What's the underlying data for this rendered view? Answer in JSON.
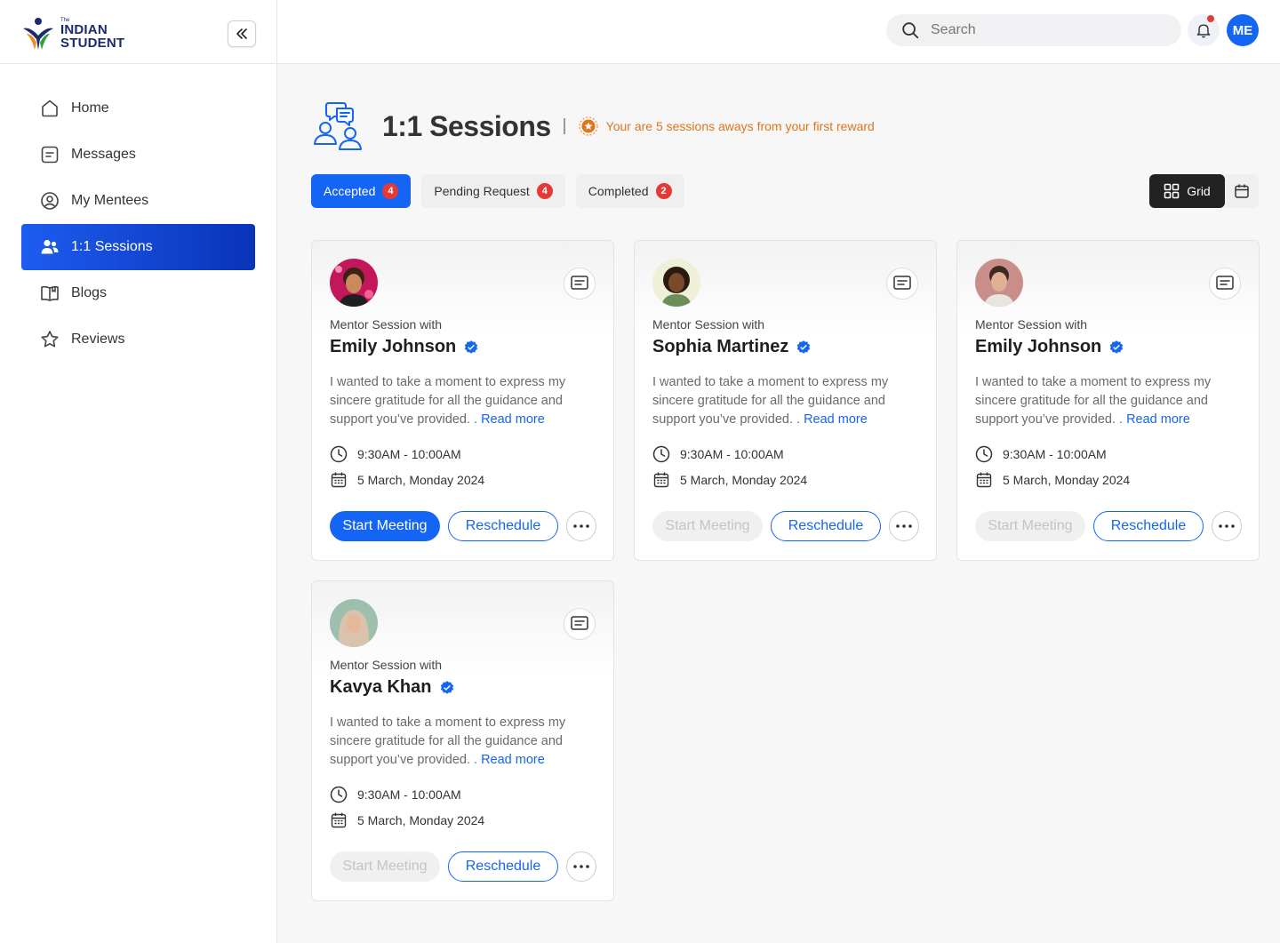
{
  "brand": {
    "small": "The",
    "line1": "INDIAN",
    "line2": "STUDENT"
  },
  "sidebar": {
    "items": [
      {
        "label": "Home",
        "icon": "home-icon"
      },
      {
        "label": "Messages",
        "icon": "message-icon"
      },
      {
        "label": "My Mentees",
        "icon": "user-circle-icon"
      },
      {
        "label": "1:1 Sessions",
        "icon": "users-icon",
        "active": true
      },
      {
        "label": "Blogs",
        "icon": "book-icon"
      },
      {
        "label": "Reviews",
        "icon": "star-icon"
      }
    ]
  },
  "header": {
    "search_placeholder": "Search",
    "avatar_initials": "ME",
    "has_notification": true
  },
  "page": {
    "title": "1:1 Sessions",
    "reward_text": "Your are 5 sessions aways from your first reward"
  },
  "tabs": [
    {
      "label": "Accepted",
      "count": "4",
      "active": true
    },
    {
      "label": "Pending Request",
      "count": "4"
    },
    {
      "label": "Completed",
      "count": "2"
    }
  ],
  "view": {
    "grid_label": "Grid"
  },
  "sessions": [
    {
      "prefix": "Mentor Session with",
      "name": "Emily Johnson",
      "description": "I wanted to take a moment to express my sincere gratitude for all the guidance and support you’ve provided. .",
      "read_more": "Read more",
      "time": "9:30AM - 10:00AM",
      "date": "5 March, Monday 2024",
      "start_label": "Start Meeting",
      "start_enabled": true,
      "reschedule_label": "Reschedule"
    },
    {
      "prefix": "Mentor Session with",
      "name": "Sophia Martinez",
      "description": "I wanted to take a moment to express my sincere gratitude for all the guidance and support you’ve provided. .",
      "read_more": "Read more",
      "time": "9:30AM - 10:00AM",
      "date": "5 March, Monday 2024",
      "start_label": "Start Meeting",
      "start_enabled": false,
      "reschedule_label": "Reschedule"
    },
    {
      "prefix": "Mentor Session with",
      "name": "Emily Johnson",
      "description": "I wanted to take a moment to express my sincere gratitude for all the guidance and support you’ve provided. .",
      "read_more": "Read more",
      "time": "9:30AM - 10:00AM",
      "date": "5 March, Monday 2024",
      "start_label": "Start Meeting",
      "start_enabled": false,
      "reschedule_label": "Reschedule"
    },
    {
      "prefix": "Mentor Session with",
      "name": "Kavya Khan",
      "description": "I wanted to take a moment to express my sincere gratitude for all the guidance and support you’ve provided. .",
      "read_more": "Read more",
      "time": "9:30AM - 10:00AM",
      "date": "5 March, Monday 2024",
      "start_label": "Start Meeting",
      "start_enabled": false,
      "reschedule_label": "Reschedule"
    }
  ],
  "colors": {
    "primary": "#1565f5",
    "badge": "#e53935",
    "reward": "#e0751a",
    "dark": "#222222"
  }
}
